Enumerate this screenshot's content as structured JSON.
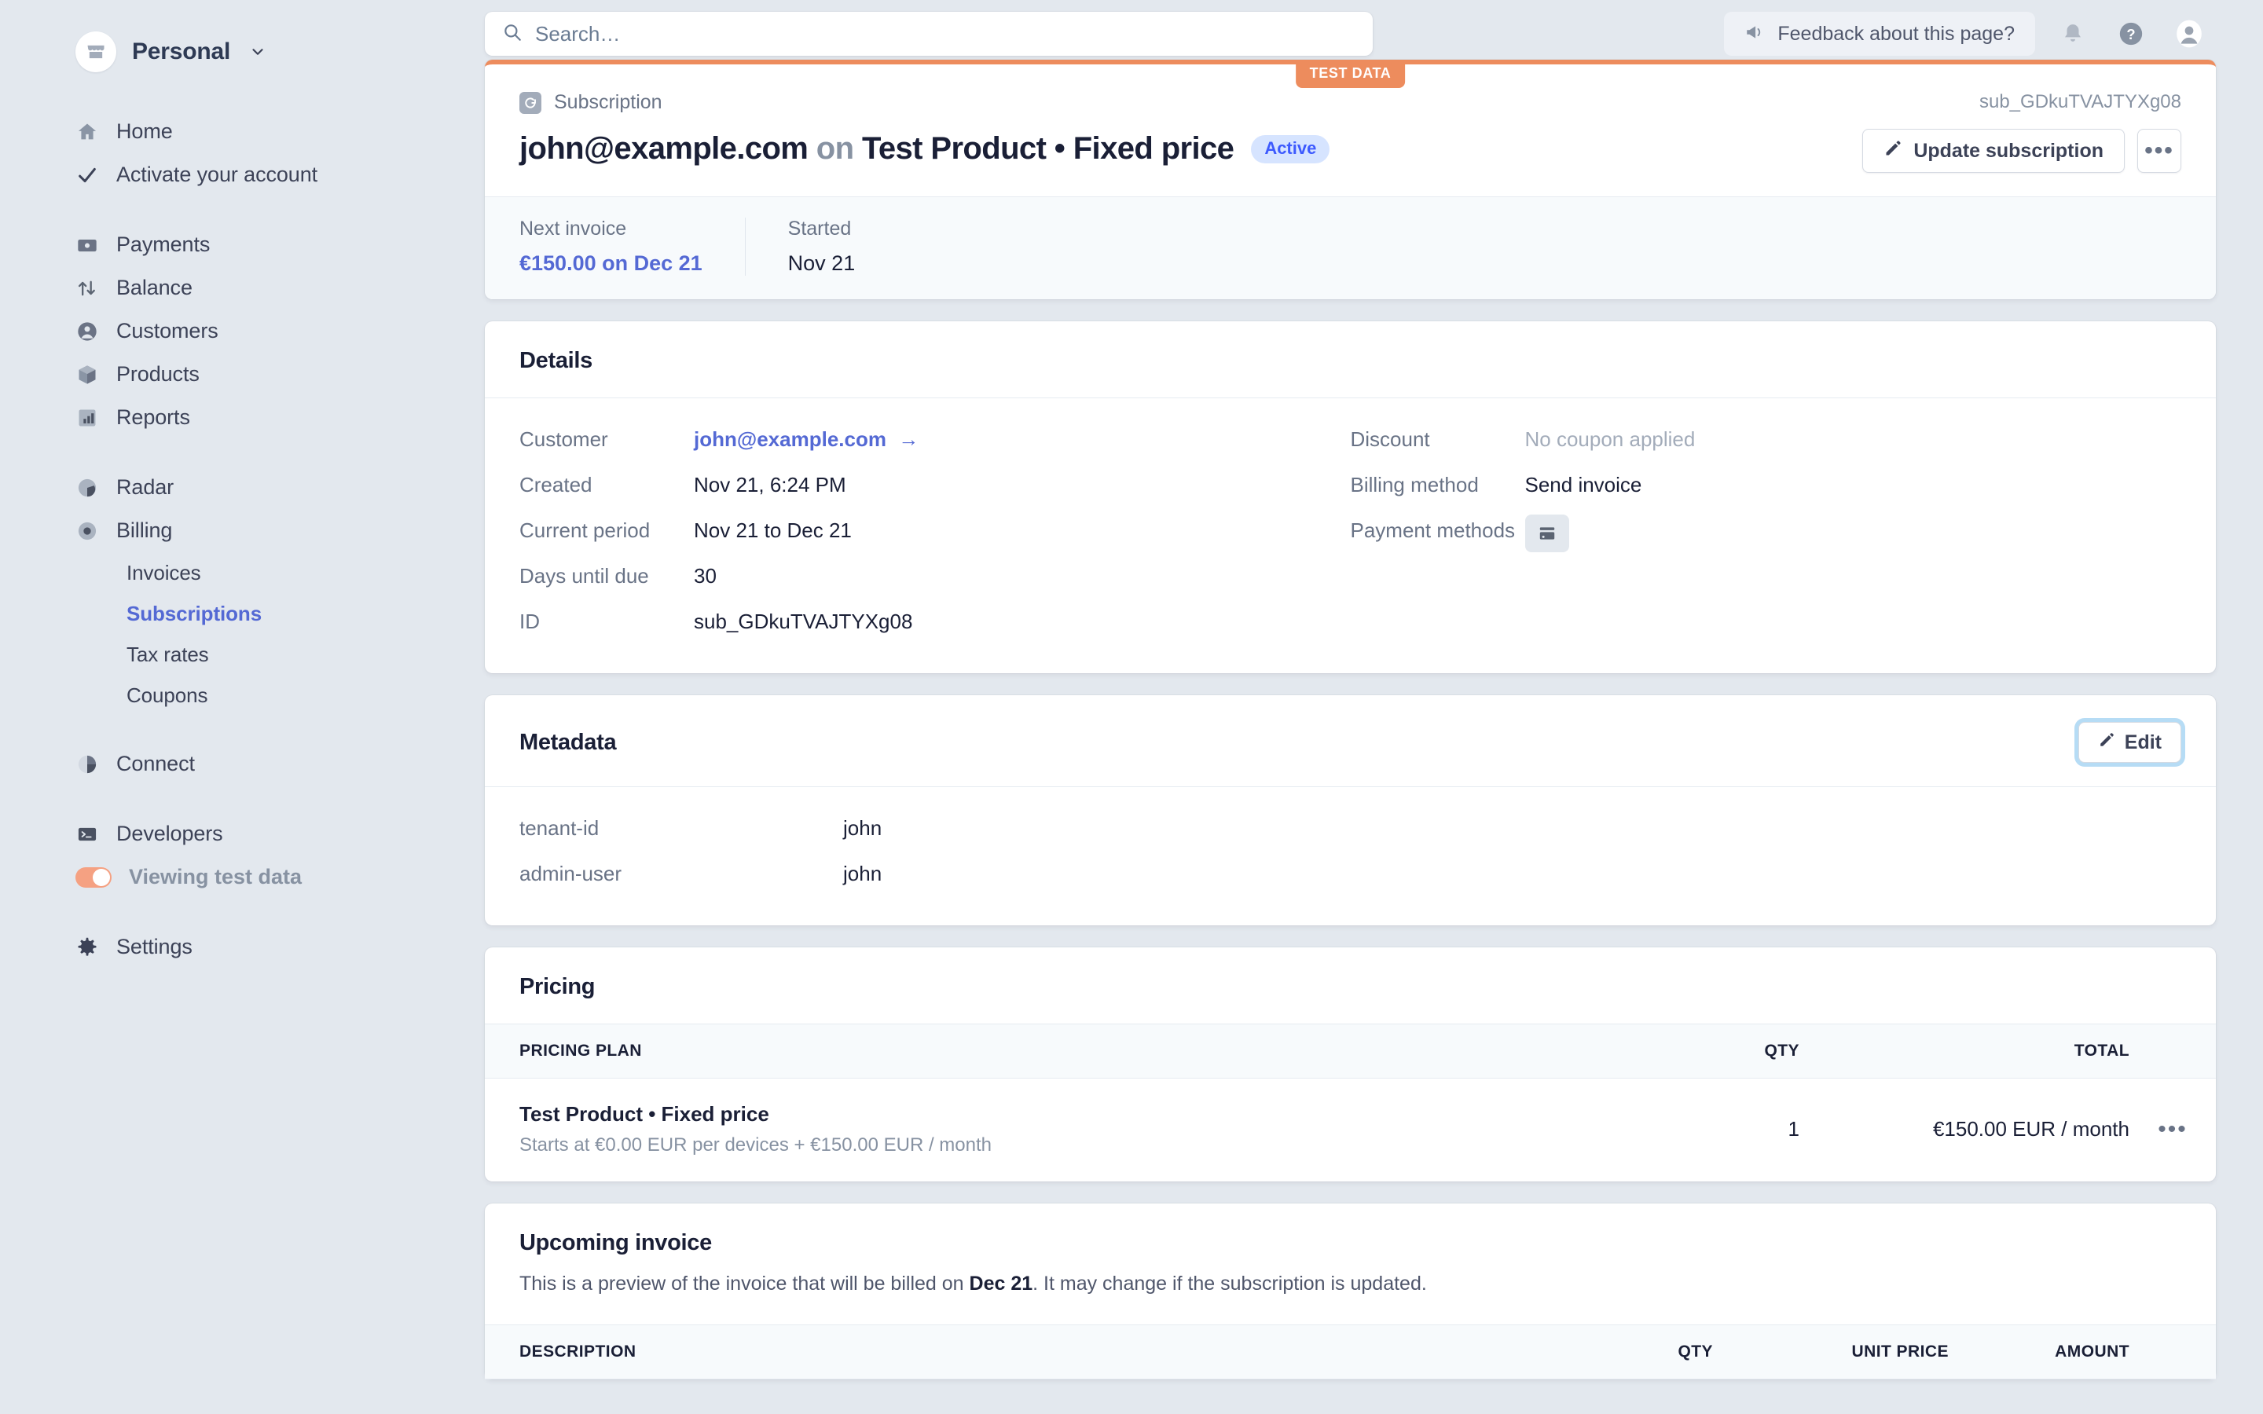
{
  "sidebar": {
    "brand": {
      "name": "Personal"
    },
    "groups": [
      {
        "items": [
          {
            "label": "Home",
            "icon": "home-icon"
          },
          {
            "label": "Activate your account",
            "icon": "check-icon"
          }
        ]
      },
      {
        "items": [
          {
            "label": "Payments",
            "icon": "payments-icon"
          },
          {
            "label": "Balance",
            "icon": "balance-icon"
          },
          {
            "label": "Customers",
            "icon": "customers-icon"
          },
          {
            "label": "Products",
            "icon": "products-icon"
          },
          {
            "label": "Reports",
            "icon": "reports-icon"
          }
        ]
      },
      {
        "items": [
          {
            "label": "Radar",
            "icon": "radar-icon"
          },
          {
            "label": "Billing",
            "icon": "billing-icon"
          }
        ],
        "sub": [
          {
            "label": "Invoices",
            "active": false
          },
          {
            "label": "Subscriptions",
            "active": true
          },
          {
            "label": "Tax rates",
            "active": false
          },
          {
            "label": "Coupons",
            "active": false
          }
        ]
      },
      {
        "items": [
          {
            "label": "Connect",
            "icon": "connect-icon"
          }
        ]
      },
      {
        "items": [
          {
            "label": "Developers",
            "icon": "developers-icon"
          }
        ]
      },
      {
        "items": [
          {
            "label": "Settings",
            "icon": "settings-icon"
          }
        ]
      }
    ],
    "test_toggle": {
      "label": "Viewing test data",
      "on": true
    }
  },
  "topbar": {
    "search_placeholder": "Search…",
    "search_value": "",
    "feedback_label": "Feedback about this page?",
    "icons": [
      "bell-icon",
      "help-icon",
      "account-avatar"
    ]
  },
  "header_card": {
    "test_badge": "TEST DATA",
    "kicker": "Subscription",
    "object_id": "sub_GDkuTVAJTYXg08",
    "title_email": "john@example.com",
    "title_on": "on",
    "title_product": "Test Product • Fixed price",
    "status_badge": "Active",
    "update_button": "Update subscription",
    "overflow_button": "•••",
    "stats": [
      {
        "label": "Next invoice",
        "value": "€150.00 on Dec 21",
        "link": true
      },
      {
        "label": "Started",
        "value": "Nov 21",
        "link": false
      }
    ]
  },
  "details": {
    "title": "Details",
    "left": [
      {
        "label": "Customer",
        "value": "john@example.com",
        "style": "link"
      },
      {
        "label": "Created",
        "value": "Nov 21, 6:24 PM",
        "style": "plain"
      },
      {
        "label": "Current period",
        "value": "Nov 21 to Dec 21",
        "style": "plain"
      },
      {
        "label": "Days until due",
        "value": "30",
        "style": "plain"
      },
      {
        "label": "ID",
        "value": "sub_GDkuTVAJTYXg08",
        "style": "plain"
      }
    ],
    "right": [
      {
        "label": "Discount",
        "value": "No coupon applied",
        "style": "muted"
      },
      {
        "label": "Billing method",
        "value": "Send invoice",
        "style": "plain"
      },
      {
        "label": "Payment methods",
        "value": "",
        "style": "card-chip"
      }
    ]
  },
  "metadata": {
    "title": "Metadata",
    "edit_label": "Edit",
    "rows": [
      {
        "key": "tenant-id",
        "value": "john"
      },
      {
        "key": "admin-user",
        "value": "john"
      }
    ]
  },
  "pricing": {
    "title": "Pricing",
    "columns": [
      "PRICING PLAN",
      "QTY",
      "TOTAL"
    ],
    "rows": [
      {
        "plan": "Test Product • Fixed price",
        "plan_sub": "Starts at €0.00 EUR per devices + €150.00 EUR / month",
        "qty": "1",
        "total": "€150.00 EUR / month",
        "overflow": "•••"
      }
    ]
  },
  "upcoming_invoice": {
    "title": "Upcoming invoice",
    "description_pre": "This is a preview of the invoice that will be billed on ",
    "description_date": "Dec 21",
    "description_post": ". It may change if the subscription is updated.",
    "columns": [
      "DESCRIPTION",
      "QTY",
      "UNIT PRICE",
      "AMOUNT"
    ]
  },
  "colors": {
    "accent": "#5469d4",
    "test_orange": "#ed8c5d",
    "page_bg": "#e3e8ee",
    "badge_active_bg": "#d6e4ff",
    "badge_active_fg": "#3d5afe"
  }
}
